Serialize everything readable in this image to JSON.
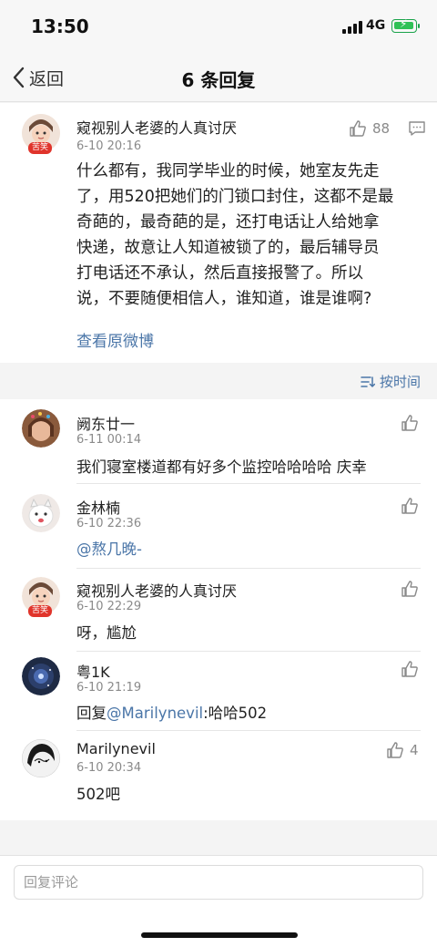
{
  "status_bar": {
    "time": "13:50",
    "network": "4G"
  },
  "nav": {
    "back_label": "返回",
    "title": "6 条回复"
  },
  "main_post": {
    "username": "窥视别人老婆的人真讨厌",
    "date": "6-10 20:16",
    "avatar_badge": "苦笑",
    "likes": "88",
    "lines": [
      "什么都有，我同学毕业的时候，她室友先走",
      "了，用520把她们的门锁口封住，这都不是最",
      "奇葩的，最奇葩的是，还打电话让人给她拿",
      "快递，故意让人知道被锁了的，最后辅导员",
      "打电话还不承认，然后直接报警了。所以",
      "说，不要随便相信人，谁知道，谁是谁啊?"
    ],
    "view_original": "查看原微博"
  },
  "sort": {
    "label": "按时间"
  },
  "comments": [
    {
      "username": "阙东廿一",
      "date": "6-11 00:14",
      "text": "我们寝室楼道都有好多个监控哈哈哈哈 庆幸",
      "likes": ""
    },
    {
      "username": "金林楠",
      "date": "6-10 22:36",
      "mention": "@熬几晚-",
      "likes": ""
    },
    {
      "username": "窥视别人老婆的人真讨厌",
      "date": "6-10 22:29",
      "text": "呀，尴尬",
      "avatar_badge": "苦笑",
      "likes": ""
    },
    {
      "username": "粤1K",
      "date": "6-10 21:19",
      "prefix": "回复",
      "mention": "@Marilynevil",
      "suffix": ":哈哈502",
      "likes": ""
    },
    {
      "username": "Marilynevil",
      "date": "6-10 20:34",
      "text": "502吧",
      "likes": "4"
    }
  ],
  "reply_box": {
    "placeholder": "回复评论"
  },
  "colors": {
    "link": "#4b76a8",
    "muted": "#8a8a8a",
    "badge": "#e0342b"
  }
}
